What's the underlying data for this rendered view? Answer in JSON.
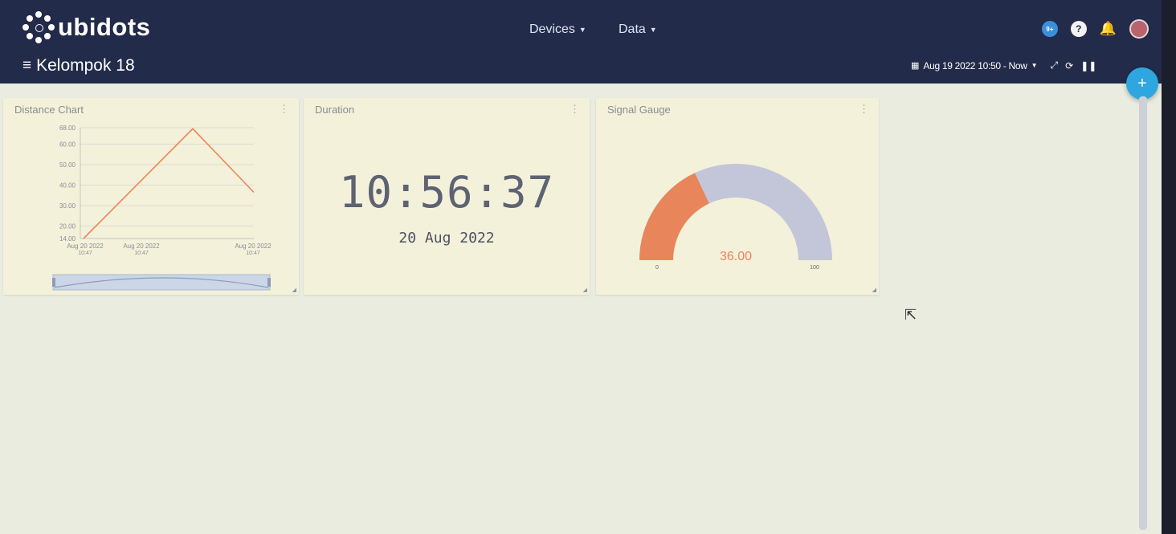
{
  "brand": {
    "name": "ubidots"
  },
  "nav": {
    "devices": "Devices",
    "data": "Data"
  },
  "header_icons": {
    "status": {
      "name": "status-icon",
      "glyph": "9+"
    },
    "help": {
      "name": "help-icon",
      "glyph": "?"
    },
    "notifications": {
      "name": "bell-icon",
      "glyph": "🔔"
    },
    "user": {
      "name": "avatar"
    }
  },
  "dashboard": {
    "title": "Kelompok 18"
  },
  "toolbar": {
    "date_range": "Aug 19 2022 10:50 - Now"
  },
  "widgets": {
    "distance": {
      "title": "Distance Chart"
    },
    "duration": {
      "title": "Duration",
      "time": "10:56:37",
      "date": "20 Aug 2022"
    },
    "gauge": {
      "title": "Signal Gauge",
      "value": 36,
      "value_label": "36.00",
      "min": 0,
      "max": 100,
      "min_label": "0",
      "max_label": "100"
    }
  },
  "colors": {
    "accent": "#e9855a",
    "gauge_track": "#c3c6d9",
    "topbar": "#232b4a",
    "fab": "#2ea6df"
  },
  "chart_data": {
    "type": "line",
    "title": "",
    "xlabel": "",
    "ylabel": "",
    "x": [
      "Aug 20 2022\n10:47",
      "",
      "Aug 20 2022\n10:47"
    ],
    "series": [
      {
        "values": [
          14,
          67.5,
          36.5
        ]
      }
    ],
    "ylim": [
      14,
      68
    ],
    "y_ticks": [
      "68.00",
      "60.00",
      "50.00",
      "40.00",
      "30.00",
      "20.00",
      "14.00"
    ],
    "x_tick_labels": [
      "Aug 20 2022",
      "Aug 20 2022",
      "Aug 20 2022"
    ],
    "x_tick_sub": [
      "10:47",
      "10:47",
      "10:47"
    ],
    "grid": true
  }
}
